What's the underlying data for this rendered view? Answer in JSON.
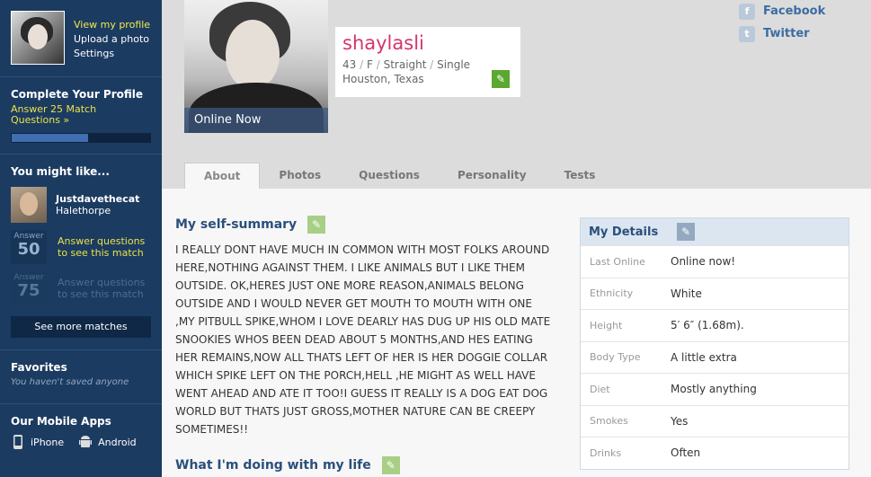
{
  "sidebar": {
    "links": [
      "View my profile",
      "Upload a photo",
      "Settings"
    ],
    "complete_profile": {
      "title": "Complete Your Profile",
      "line1": "Answer 25 Match",
      "line2": "Questions »",
      "progress": 0.55
    },
    "you_might_like": {
      "title": "You might like...",
      "match_name": "Justdavethecat",
      "match_location": "Halethorpe",
      "answer_label": "Answer",
      "answer1_num": "50",
      "answer1_text1": "Answer questions",
      "answer1_text2": "to see this match",
      "answer2_num": "75",
      "answer2_text1": "Answer questions",
      "answer2_text2": "to see this match",
      "see_more": "See more matches"
    },
    "favorites": {
      "title": "Favorites",
      "empty": "You haven't saved anyone"
    },
    "mobile": {
      "title": "Our Mobile Apps",
      "iphone": "iPhone",
      "android": "Android"
    }
  },
  "header": {
    "online_now": "Online Now",
    "username": "shaylasli",
    "age": "43",
    "gender": "F",
    "orientation": "Straight",
    "status": "Single",
    "location": "Houston, Texas",
    "separator": "/",
    "social": {
      "facebook": "Facebook",
      "twitter": "Twitter"
    },
    "tabs": [
      "About",
      "Photos",
      "Questions",
      "Personality",
      "Tests"
    ]
  },
  "main": {
    "self_summary_title": "My self-summary",
    "self_summary": "I REALLY DONT HAVE MUCH IN COMMON WITH MOST FOLKS AROUND HERE,NOTHING AGAINST THEM. I LIKE ANIMALS BUT I LIKE THEM OUTSIDE. OK,HERES JUST ONE MORE REASON,ANIMALS BELONG OUTSIDE AND I WOULD NEVER GET MOUTH TO MOUTH WITH ONE ,MY PITBULL SPIKE,WHOM I LOVE DEARLY HAS DUG UP HIS OLD MATE SNOOKIES WHOS BEEN DEAD ABOUT 5 MONTHS,AND HES EATING HER REMAINS,NOW ALL THATS LEFT OF HER IS HER DOGGIE COLLAR WHICH SPIKE LEFT ON THE PORCH,HELL ,HE MIGHT AS WELL HAVE WENT AHEAD AND ATE IT TOO!I GUESS IT REALLY IS A DOG EAT DOG WORLD BUT THATS JUST GROSS,MOTHER NATURE CAN BE CREEPY SOMETIMES!!",
    "doing_title": "What I'm doing with my life",
    "details": {
      "title": "My Details",
      "rows": [
        {
          "k": "Last Online",
          "v": "Online now!"
        },
        {
          "k": "Ethnicity",
          "v": "White"
        },
        {
          "k": "Height",
          "v": "5′ 6″ (1.68m)."
        },
        {
          "k": "Body Type",
          "v": "A little extra"
        },
        {
          "k": "Diet",
          "v": "Mostly anything"
        },
        {
          "k": "Smokes",
          "v": "Yes"
        },
        {
          "k": "Drinks",
          "v": "Often"
        }
      ]
    }
  },
  "colors": {
    "sidebar_bg": "#1c3b61",
    "username": "#d6336c",
    "heading_blue": "#2a4f7c",
    "edit_green": "#5aa830"
  }
}
